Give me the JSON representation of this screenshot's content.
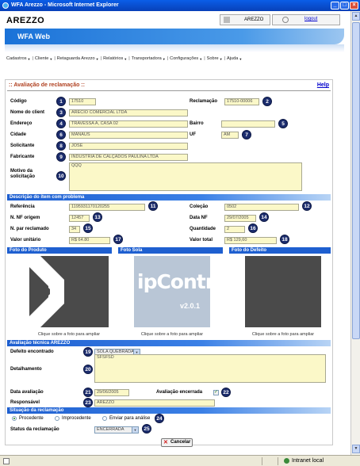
{
  "window": {
    "title": "WFA Arezzo - Microsoft Internet Explorer",
    "status_zone": "Intranet local"
  },
  "header": {
    "logo": "AREZZO",
    "user_label": "AREZZO",
    "logout": "logout",
    "banner": "WFA Web"
  },
  "menu": [
    "Cadastros",
    "Cliente",
    "Retaguarda Arezzo",
    "Relatórios",
    "Transportadora",
    "Configurações",
    "Sobre",
    "Ajuda"
  ],
  "panel": {
    "title": ":: Avaliação de reclamação ::",
    "help": "Help"
  },
  "form": {
    "codigo": {
      "label": "Código",
      "value": "17510",
      "badge": "1"
    },
    "reclamacao": {
      "label": "Reclamação",
      "value": "17510-00006",
      "badge": "2"
    },
    "nome_cliente": {
      "label": "Nome do client",
      "value": "ARECIO COMERCIAL LTDA",
      "badge": "3"
    },
    "endereco": {
      "label": "Endereço",
      "value": "TRAVESSA A, CASA 02",
      "badge": "4"
    },
    "bairro": {
      "label": "Bairro",
      "value": "",
      "badge": "5"
    },
    "cidade": {
      "label": "Cidade",
      "value": "MANAUS",
      "badge": "6"
    },
    "uf": {
      "label": "UF",
      "value": "AM",
      "badge": "7"
    },
    "solicitante": {
      "label": "Solicitante",
      "value": "JOSE",
      "badge": "8"
    },
    "fabricante": {
      "label": "Fabricante",
      "value": "INDUSTRIA DE CALÇADOS PAULINA LTDA",
      "badge": "9"
    },
    "motivo": {
      "label": "Motivo da solicitação",
      "value": "QQQ",
      "badge": "10"
    }
  },
  "item": {
    "section": "Descrição do ítem com problema",
    "referencia": {
      "label": "Referência",
      "value": "1195931170120255",
      "badge": "11"
    },
    "colecao": {
      "label": "Coleção",
      "value": "0502",
      "badge": "12"
    },
    "nf_origem": {
      "label": "N. NF origem",
      "value": "12457",
      "badge": "13"
    },
    "data_nf": {
      "label": "Data NF",
      "value": "29/07/2005",
      "badge": "14"
    },
    "par_reclamado": {
      "label": "N. par reclamado",
      "value": "34",
      "badge": "15"
    },
    "quantidade": {
      "label": "Quantidade",
      "value": "2",
      "badge": "16"
    },
    "valor_unitario": {
      "label": "Valor unitário",
      "value": "R$ 64.80",
      "badge": "17"
    },
    "valor_total": {
      "label": "Valor total",
      "value": "R$ 129,60",
      "badge": "18"
    }
  },
  "photos": {
    "produto": {
      "title": "Foto do Produto",
      "caption": "Clique sobre a foto para ampliar"
    },
    "sola": {
      "title": "Foto Sola",
      "caption": "Clique sobre a foto para ampliar",
      "image_text_main": "ipControl",
      "image_text_version": "v2.0.1"
    },
    "defeito": {
      "title": "Foto do Defeito",
      "caption": "Clique sobre a foto para ampliar"
    }
  },
  "avaliacao": {
    "section": "Avaliação técnica AREZZO",
    "defeito": {
      "label": "Defeito encontrado",
      "value": "SOLA QUEBRADA",
      "badge": "19"
    },
    "detalhamento": {
      "label": "Detalhamento",
      "value": "SFSFSD",
      "badge": "20"
    },
    "data": {
      "label": "Data avaliação",
      "value": "29/06/2005",
      "badge": "21"
    },
    "encerrada": {
      "label": "Avaliação encerrada",
      "checked": true,
      "badge": "22"
    },
    "responsavel": {
      "label": "Responsável",
      "value": "AREZZO",
      "badge": "23"
    }
  },
  "situacao": {
    "section": "Situação da reclamação",
    "options": [
      "Procedente",
      "Improcedente",
      "Enviar para análise"
    ],
    "selected": "Procedente",
    "badge_options": "24",
    "status": {
      "label": "Status da reclamação",
      "value": "ENCERRADA",
      "badge": "25"
    }
  },
  "buttons": {
    "cancel": "Cancelar"
  }
}
